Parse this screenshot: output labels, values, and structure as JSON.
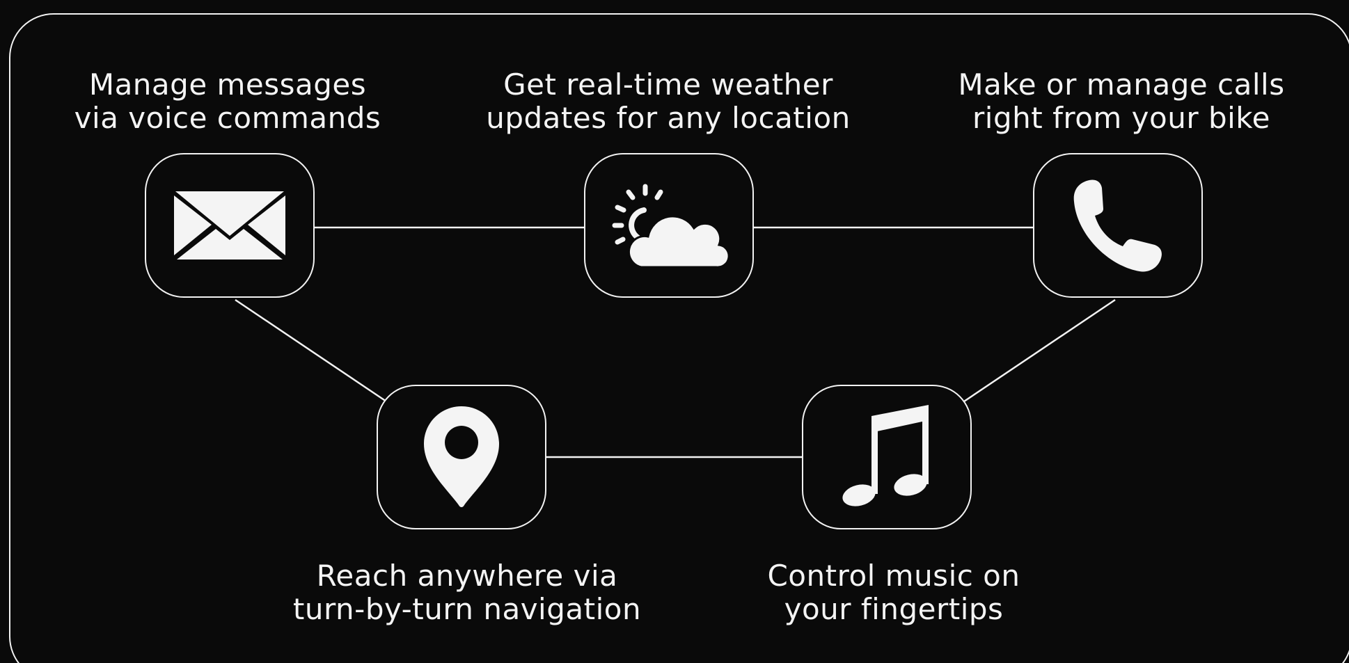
{
  "colors": {
    "background": "#0a0a0a",
    "foreground": "#f2f2f2"
  },
  "features": [
    {
      "id": "messages",
      "icon": "envelope-icon",
      "line1": "Manage messages",
      "line2": "via voice commands"
    },
    {
      "id": "weather",
      "icon": "sun-cloud-icon",
      "line1": "Get real-time weather",
      "line2": "updates for any location"
    },
    {
      "id": "calls",
      "icon": "phone-icon",
      "line1": "Make or manage calls",
      "line2": "right from your bike"
    },
    {
      "id": "navigation",
      "icon": "map-pin-icon",
      "line1": "Reach anywhere via",
      "line2": "turn-by-turn navigation"
    },
    {
      "id": "music",
      "icon": "music-note-icon",
      "line1": "Control music on",
      "line2": "your fingertips"
    }
  ],
  "connections": [
    [
      "messages",
      "weather"
    ],
    [
      "weather",
      "calls"
    ],
    [
      "messages",
      "navigation"
    ],
    [
      "calls",
      "music"
    ],
    [
      "navigation",
      "music"
    ]
  ]
}
